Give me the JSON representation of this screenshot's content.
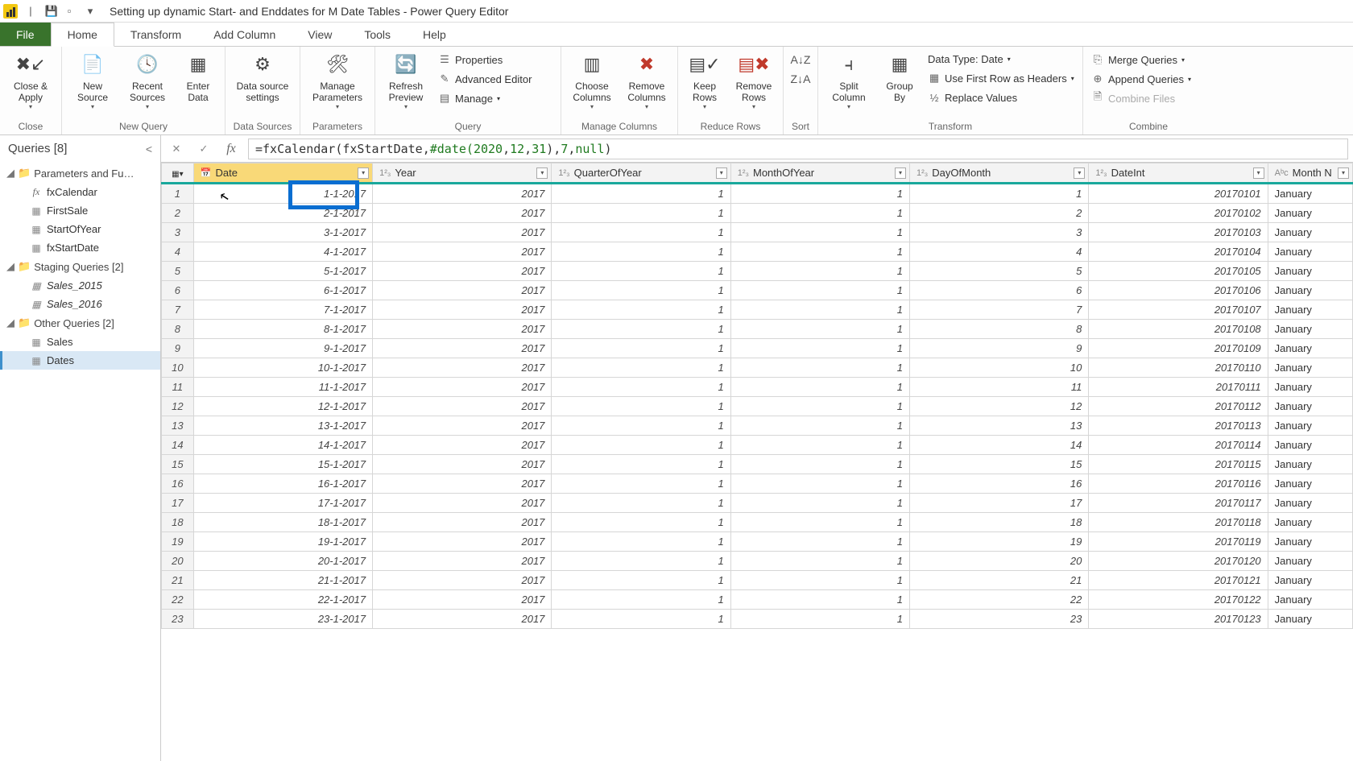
{
  "window": {
    "title": "Setting up dynamic Start- and Enddates for M Date Tables - Power Query Editor"
  },
  "tabs": [
    "File",
    "Home",
    "Transform",
    "Add Column",
    "View",
    "Tools",
    "Help"
  ],
  "activeTab": "Home",
  "ribbon": {
    "close": {
      "closeApply": "Close &\nApply",
      "label": "Close"
    },
    "newQuery": {
      "newSource": "New\nSource",
      "recentSources": "Recent\nSources",
      "enterData": "Enter\nData",
      "label": "New Query"
    },
    "dataSources": {
      "settings": "Data source\nsettings",
      "label": "Data Sources"
    },
    "parameters": {
      "manage": "Manage\nParameters",
      "label": "Parameters"
    },
    "query": {
      "refresh": "Refresh\nPreview",
      "properties": "Properties",
      "advanced": "Advanced Editor",
      "manage": "Manage",
      "label": "Query"
    },
    "manageColumns": {
      "choose": "Choose\nColumns",
      "remove": "Remove\nColumns",
      "label": "Manage Columns"
    },
    "reduceRows": {
      "keep": "Keep\nRows",
      "remove": "Remove\nRows",
      "label": "Reduce Rows"
    },
    "sort": {
      "label": "Sort"
    },
    "transform": {
      "split": "Split\nColumn",
      "group": "Group\nBy",
      "dataType": "Data Type: Date",
      "firstRow": "Use First Row as Headers",
      "replace": "Replace Values",
      "label": "Transform"
    },
    "combine": {
      "merge": "Merge Queries",
      "append": "Append Queries",
      "files": "Combine Files",
      "label": "Combine"
    }
  },
  "queriesPane": {
    "header": "Queries [8]",
    "groups": [
      {
        "label": "Parameters and Fu…",
        "items": [
          {
            "name": "fxCalendar",
            "fx": true
          },
          {
            "name": "FirstSale"
          },
          {
            "name": "StartOfYear"
          },
          {
            "name": "fxStartDate"
          }
        ]
      },
      {
        "label": "Staging Queries [2]",
        "items": [
          {
            "name": "Sales_2015",
            "italic": true
          },
          {
            "name": "Sales_2016",
            "italic": true
          }
        ]
      },
      {
        "label": "Other Queries [2]",
        "items": [
          {
            "name": "Sales"
          },
          {
            "name": "Dates",
            "selected": true
          }
        ]
      }
    ]
  },
  "formula": {
    "prefix": "= ",
    "fn1": "fxCalendar( ",
    "arg1": "fxStartDate, ",
    "datefn": "#date( ",
    "y": "2020",
    "c1": ", ",
    "m": "12",
    "c2": ", ",
    "d": "31",
    "close1": "), ",
    "n7": "7",
    "c3": ", ",
    "nul": "null",
    "close2": ")"
  },
  "columns": [
    {
      "key": "Date",
      "label": "Date",
      "type": "date",
      "align": "r"
    },
    {
      "key": "Year",
      "label": "Year",
      "type": "num",
      "align": "r"
    },
    {
      "key": "QuarterOfYear",
      "label": "QuarterOfYear",
      "type": "num",
      "align": "r"
    },
    {
      "key": "MonthOfYear",
      "label": "MonthOfYear",
      "type": "num",
      "align": "r"
    },
    {
      "key": "DayOfMonth",
      "label": "DayOfMonth",
      "type": "num",
      "align": "r"
    },
    {
      "key": "DateInt",
      "label": "DateInt",
      "type": "num",
      "align": "r"
    },
    {
      "key": "MonthN",
      "label": "Month N",
      "type": "text",
      "align": "l"
    }
  ],
  "rows": [
    {
      "n": 1,
      "Date": "1-1-2017",
      "Year": "2017",
      "QuarterOfYear": "1",
      "MonthOfYear": "1",
      "DayOfMonth": "1",
      "DateInt": "20170101",
      "MonthN": "January"
    },
    {
      "n": 2,
      "Date": "2-1-2017",
      "Year": "2017",
      "QuarterOfYear": "1",
      "MonthOfYear": "1",
      "DayOfMonth": "2",
      "DateInt": "20170102",
      "MonthN": "January"
    },
    {
      "n": 3,
      "Date": "3-1-2017",
      "Year": "2017",
      "QuarterOfYear": "1",
      "MonthOfYear": "1",
      "DayOfMonth": "3",
      "DateInt": "20170103",
      "MonthN": "January"
    },
    {
      "n": 4,
      "Date": "4-1-2017",
      "Year": "2017",
      "QuarterOfYear": "1",
      "MonthOfYear": "1",
      "DayOfMonth": "4",
      "DateInt": "20170104",
      "MonthN": "January"
    },
    {
      "n": 5,
      "Date": "5-1-2017",
      "Year": "2017",
      "QuarterOfYear": "1",
      "MonthOfYear": "1",
      "DayOfMonth": "5",
      "DateInt": "20170105",
      "MonthN": "January"
    },
    {
      "n": 6,
      "Date": "6-1-2017",
      "Year": "2017",
      "QuarterOfYear": "1",
      "MonthOfYear": "1",
      "DayOfMonth": "6",
      "DateInt": "20170106",
      "MonthN": "January"
    },
    {
      "n": 7,
      "Date": "7-1-2017",
      "Year": "2017",
      "QuarterOfYear": "1",
      "MonthOfYear": "1",
      "DayOfMonth": "7",
      "DateInt": "20170107",
      "MonthN": "January"
    },
    {
      "n": 8,
      "Date": "8-1-2017",
      "Year": "2017",
      "QuarterOfYear": "1",
      "MonthOfYear": "1",
      "DayOfMonth": "8",
      "DateInt": "20170108",
      "MonthN": "January"
    },
    {
      "n": 9,
      "Date": "9-1-2017",
      "Year": "2017",
      "QuarterOfYear": "1",
      "MonthOfYear": "1",
      "DayOfMonth": "9",
      "DateInt": "20170109",
      "MonthN": "January"
    },
    {
      "n": 10,
      "Date": "10-1-2017",
      "Year": "2017",
      "QuarterOfYear": "1",
      "MonthOfYear": "1",
      "DayOfMonth": "10",
      "DateInt": "20170110",
      "MonthN": "January"
    },
    {
      "n": 11,
      "Date": "11-1-2017",
      "Year": "2017",
      "QuarterOfYear": "1",
      "MonthOfYear": "1",
      "DayOfMonth": "11",
      "DateInt": "20170111",
      "MonthN": "January"
    },
    {
      "n": 12,
      "Date": "12-1-2017",
      "Year": "2017",
      "QuarterOfYear": "1",
      "MonthOfYear": "1",
      "DayOfMonth": "12",
      "DateInt": "20170112",
      "MonthN": "January"
    },
    {
      "n": 13,
      "Date": "13-1-2017",
      "Year": "2017",
      "QuarterOfYear": "1",
      "MonthOfYear": "1",
      "DayOfMonth": "13",
      "DateInt": "20170113",
      "MonthN": "January"
    },
    {
      "n": 14,
      "Date": "14-1-2017",
      "Year": "2017",
      "QuarterOfYear": "1",
      "MonthOfYear": "1",
      "DayOfMonth": "14",
      "DateInt": "20170114",
      "MonthN": "January"
    },
    {
      "n": 15,
      "Date": "15-1-2017",
      "Year": "2017",
      "QuarterOfYear": "1",
      "MonthOfYear": "1",
      "DayOfMonth": "15",
      "DateInt": "20170115",
      "MonthN": "January"
    },
    {
      "n": 16,
      "Date": "16-1-2017",
      "Year": "2017",
      "QuarterOfYear": "1",
      "MonthOfYear": "1",
      "DayOfMonth": "16",
      "DateInt": "20170116",
      "MonthN": "January"
    },
    {
      "n": 17,
      "Date": "17-1-2017",
      "Year": "2017",
      "QuarterOfYear": "1",
      "MonthOfYear": "1",
      "DayOfMonth": "17",
      "DateInt": "20170117",
      "MonthN": "January"
    },
    {
      "n": 18,
      "Date": "18-1-2017",
      "Year": "2017",
      "QuarterOfYear": "1",
      "MonthOfYear": "1",
      "DayOfMonth": "18",
      "DateInt": "20170118",
      "MonthN": "January"
    },
    {
      "n": 19,
      "Date": "19-1-2017",
      "Year": "2017",
      "QuarterOfYear": "1",
      "MonthOfYear": "1",
      "DayOfMonth": "19",
      "DateInt": "20170119",
      "MonthN": "January"
    },
    {
      "n": 20,
      "Date": "20-1-2017",
      "Year": "2017",
      "QuarterOfYear": "1",
      "MonthOfYear": "1",
      "DayOfMonth": "20",
      "DateInt": "20170120",
      "MonthN": "January"
    },
    {
      "n": 21,
      "Date": "21-1-2017",
      "Year": "2017",
      "QuarterOfYear": "1",
      "MonthOfYear": "1",
      "DayOfMonth": "21",
      "DateInt": "20170121",
      "MonthN": "January"
    },
    {
      "n": 22,
      "Date": "22-1-2017",
      "Year": "2017",
      "QuarterOfYear": "1",
      "MonthOfYear": "1",
      "DayOfMonth": "22",
      "DateInt": "20170122",
      "MonthN": "January"
    },
    {
      "n": 23,
      "Date": "23-1-2017",
      "Year": "2017",
      "QuarterOfYear": "1",
      "MonthOfYear": "1",
      "DayOfMonth": "23",
      "DateInt": "20170123",
      "MonthN": "January"
    }
  ]
}
